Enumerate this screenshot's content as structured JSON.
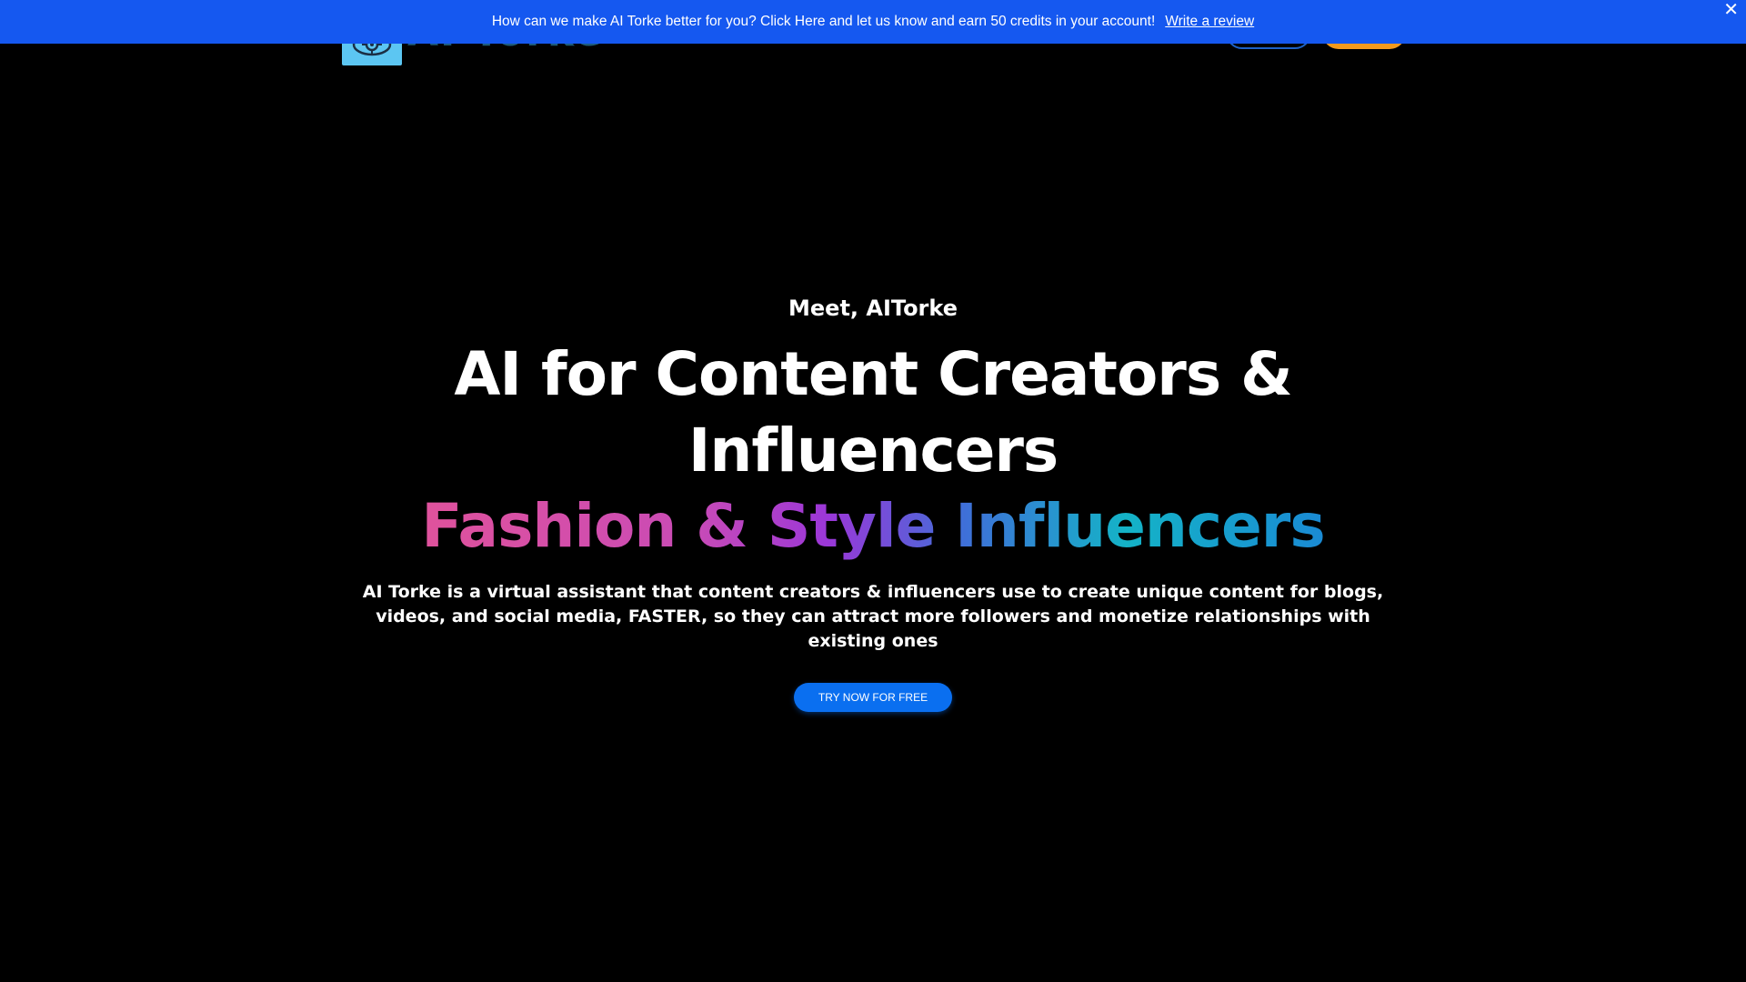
{
  "banner": {
    "message": "How can we make AI Torke better for you? Click Here and let us know and earn 50 credits in your account!",
    "link_label": "Write a review",
    "close_label": "✕"
  },
  "header": {
    "logo_text": "AI Torke"
  },
  "hero": {
    "eyebrow": "Meet, AITorke",
    "title": "AI for Content Creators & Influencers",
    "rotating_text": "Fashion & Style Influencers",
    "description": "AI Torke is a virtual assistant that content creators & influencers use to create unique content for blogs, videos, and social media, FASTER, so they can attract more followers and monetize relationships with existing ones",
    "cta_label": "TRY NOW FOR FREE"
  },
  "colors": {
    "banner_bg": "#1558f0",
    "page_bg": "#000000",
    "cta_bg": "#0a6ff0",
    "signup_btn": "#f39a1d",
    "login_btn_border": "#1e63c8",
    "logo_bg": "#5cc6f2"
  },
  "icons": {
    "logo": "brain-gear-icon",
    "close": "close-icon"
  }
}
